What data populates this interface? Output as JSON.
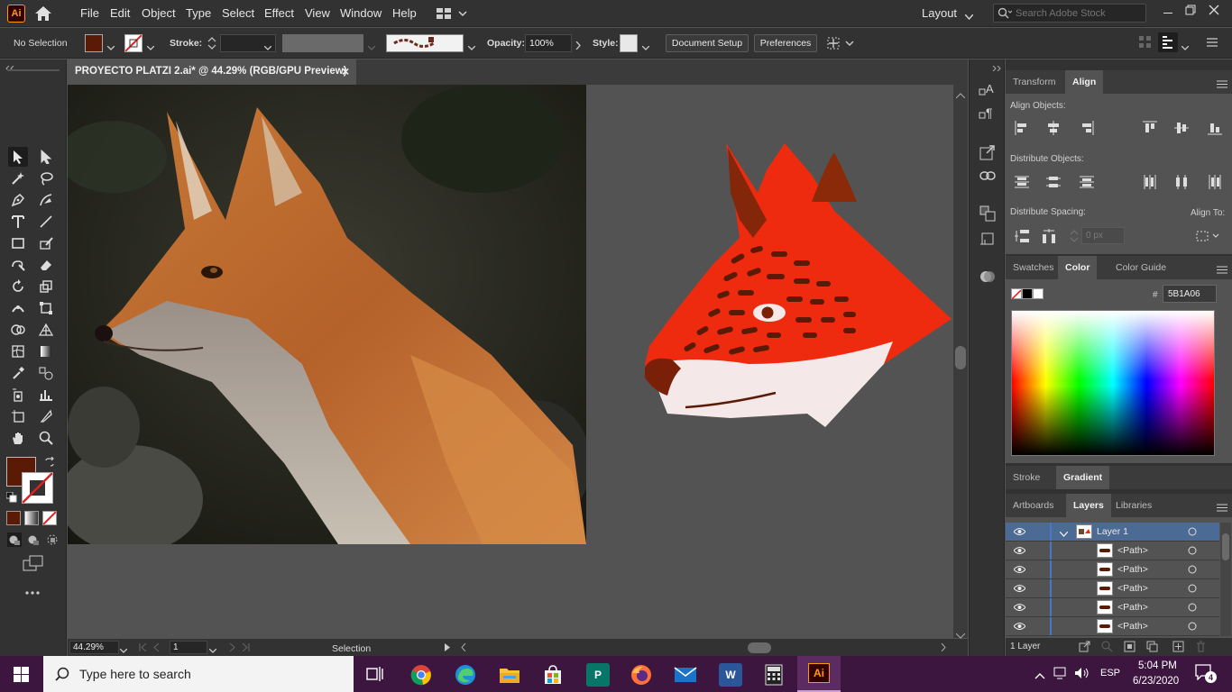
{
  "app": {
    "logo_text": "Ai",
    "workspace": "Layout",
    "search_placeholder": "Search Adobe Stock"
  },
  "menu": [
    "File",
    "Edit",
    "Object",
    "Type",
    "Select",
    "Effect",
    "View",
    "Window",
    "Help"
  ],
  "control": {
    "selection": "No Selection",
    "stroke_label": "Stroke:",
    "opacity_label": "Opacity:",
    "opacity_value": "100%",
    "style_label": "Style:",
    "document_setup": "Document Setup",
    "preferences": "Preferences",
    "fill_color": "#5b1a06"
  },
  "document": {
    "tab_title": "PROYECTO PLATZI 2.ai* @ 44.29% (RGB/GPU Preview)",
    "close_glyph": "×"
  },
  "status": {
    "zoom": "44.29%",
    "artboard": "1",
    "tool": "Selection"
  },
  "panels": {
    "top_tabs": [
      "Transform",
      "Align"
    ],
    "align_objects": "Align Objects:",
    "distribute_objects": "Distribute Objects:",
    "distribute_spacing": "Distribute Spacing:",
    "align_to": "Align To:",
    "spacing_value": "0 px",
    "color_tabs": [
      "Swatches",
      "Color",
      "Color Guide"
    ],
    "hex_symbol": "#",
    "hex_value": "5B1A06",
    "stroke_tabs": [
      "Stroke",
      "Gradient"
    ],
    "layer_tabs": [
      "Artboards",
      "Layers",
      "Libraries"
    ],
    "layer_name": "Layer 1",
    "paths": [
      "<Path>",
      "<Path>",
      "<Path>",
      "<Path>",
      "<Path>"
    ],
    "layer_count": "1 Layer"
  },
  "taskbar": {
    "search_placeholder": "Type here to search",
    "language": "ESP",
    "time": "5:04 PM",
    "date": "6/23/2020",
    "notifications": "4",
    "ai_label": "Ai",
    "publisher_label": "P",
    "word_label": "W"
  },
  "colors": {
    "accent": "#5b1a06",
    "fox_orange": "#ee2b0f",
    "fox_dark": "#5b1a06",
    "fox_white": "#f5e8e8",
    "layer_blue": "#4a76c7",
    "taskbar": "#3d1640"
  }
}
